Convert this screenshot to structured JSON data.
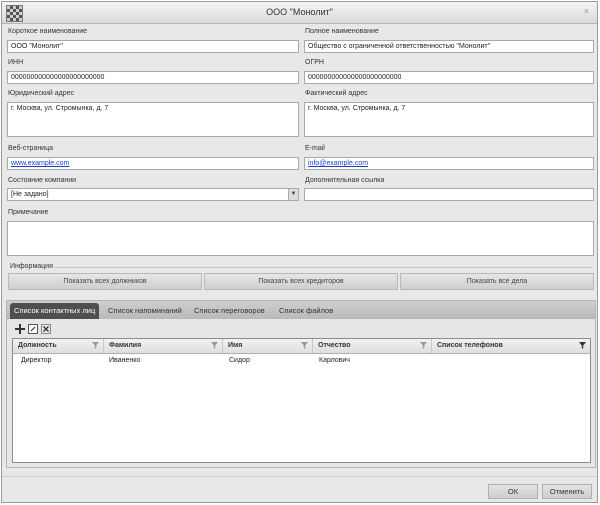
{
  "window": {
    "title": "ООО \"Монолит\"",
    "close_glyph": "×"
  },
  "form": {
    "short_name": {
      "label": "Короткое наименование",
      "value": "ООО \"Монолит\""
    },
    "full_name": {
      "label": "Полное наименование",
      "value": "Общество с ограниченной ответственностью \"Монолит\""
    },
    "inn": {
      "label": "ИНН",
      "value": "000000000000000000000000"
    },
    "ogrn": {
      "label": "ОГРН",
      "value": "000000000000000000000000"
    },
    "legal_address": {
      "label": "Юридический адрес",
      "value": "г. Москва, ул. Стромынка, д. 7"
    },
    "actual_address": {
      "label": "Фактический адрес",
      "value": "г. Москва, ул. Стромынка, д. 7"
    },
    "website": {
      "label": "Веб-страница",
      "value": "www.example.com"
    },
    "email": {
      "label": "E-mail",
      "value": "info@example.com"
    },
    "company_state": {
      "label": "Состояние компании",
      "value": "[Не задано]"
    },
    "extra_link": {
      "label": "Дополнительная ссылка",
      "value": ""
    },
    "note": {
      "label": "Примечание",
      "value": ""
    }
  },
  "info": {
    "heading": "Информация",
    "buttons": [
      "Показать всех должников",
      "Показать всех кредиторов",
      "Показать все дела"
    ]
  },
  "tabs": [
    {
      "label": "Список контактных лиц",
      "active": true
    },
    {
      "label": "Список напоминаний",
      "active": false
    },
    {
      "label": "Список переговоров",
      "active": false
    },
    {
      "label": "Список файлов",
      "active": false
    }
  ],
  "toolbar": {
    "icons": [
      "add-icon",
      "edit-icon",
      "delete-icon"
    ]
  },
  "contacts_table": {
    "columns": [
      "Должность",
      "Фамилия",
      "Имя",
      "Отчество",
      "Список телефонов"
    ],
    "rows": [
      [
        "Директор",
        "Иваненко",
        "Сидор",
        "Карлович",
        ""
      ]
    ]
  },
  "footer": {
    "ok_label": "ОК",
    "cancel_label": "Отменить"
  },
  "colors": {
    "active_tab": "#4f4f4f",
    "link": "#1a3fc9"
  }
}
